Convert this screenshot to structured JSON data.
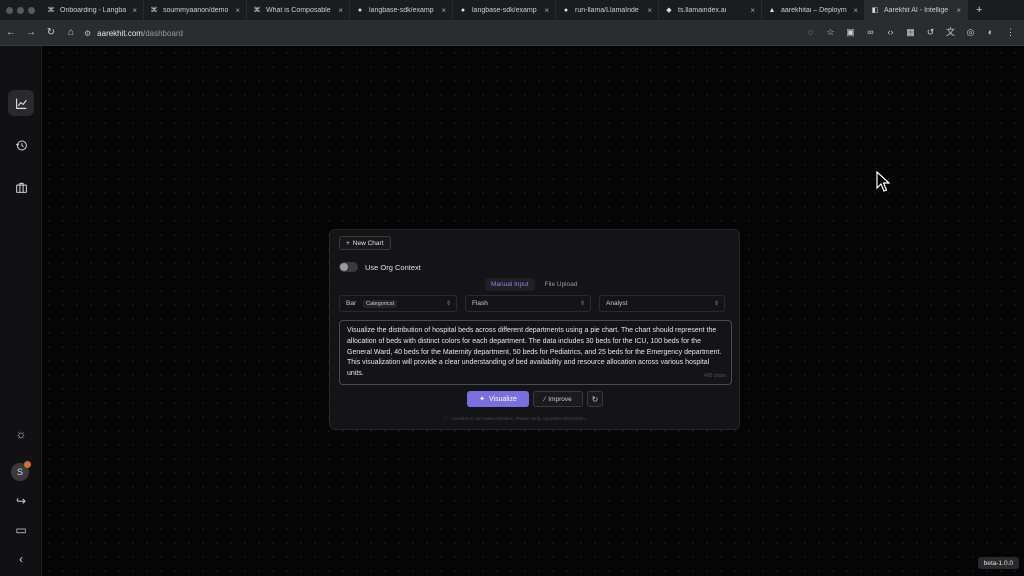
{
  "browser": {
    "tabs": [
      {
        "title": "Onboarding - Langba",
        "icon": "langbase-icon"
      },
      {
        "title": "soummyaanon/demo",
        "icon": "langbase-icon"
      },
      {
        "title": "What is Composable",
        "icon": "langbase-icon"
      },
      {
        "title": "langbase-sdk/examp",
        "icon": "github-icon"
      },
      {
        "title": "langbase-sdk/examp",
        "icon": "github-icon"
      },
      {
        "title": "run-llama/LlamaInde",
        "icon": "github-icon"
      },
      {
        "title": "ts.llamaindex.ai",
        "icon": "llama-icon"
      },
      {
        "title": "aarekhitai – Deploym",
        "icon": "vercel-icon"
      },
      {
        "title": "Aarekhit AI - Intellige",
        "icon": "aarekhit-icon"
      }
    ],
    "address": {
      "domain": "aarekhit.com",
      "path": "/dashboard"
    }
  },
  "sidebar": {
    "items": [
      {
        "name": "charts",
        "icon": "line-chart-icon"
      },
      {
        "name": "history",
        "icon": "history-icon"
      },
      {
        "name": "briefcase",
        "icon": "briefcase-icon"
      }
    ],
    "bottom": {
      "theme_icon": "sun-icon",
      "avatar_letter": "S",
      "logout_icon": "logout-icon",
      "feedback_icon": "chat-icon",
      "collapse_icon": "chevron-left-icon"
    }
  },
  "card": {
    "new_chart_label": "New Chart",
    "org_context_label": "Use Org Context",
    "input_tabs": {
      "manual": "Manual Input",
      "upload": "File Upload"
    },
    "chart_type": {
      "value": "Bar",
      "chip": "Categorical"
    },
    "model": {
      "value": "Flash"
    },
    "role": {
      "value": "Analyst"
    },
    "prompt": "Visualize the distribution of hospital beds across different departments using a pie chart. The chart should represent the allocation of beds with distinct colors for each department. The data includes 30 beds for the ICU, 100 beds for the General Ward, 40 beds for the Maternity department, 50 beds for Pediatrics, and 25 beds for the Emergency department. This visualization will provide a clear understanding of bed availability and resource allocation across various hospital units.",
    "char_count": "495 chars",
    "visualize_label": "Visualize",
    "improve_label": "Improve",
    "disclaimer": "Aarekhit AI can make mistakes. Please verify important information."
  },
  "version": "beta-1.0.0",
  "colors": {
    "accent": "#7b6fe0",
    "background": "#050505",
    "sidebar": "#111113"
  }
}
